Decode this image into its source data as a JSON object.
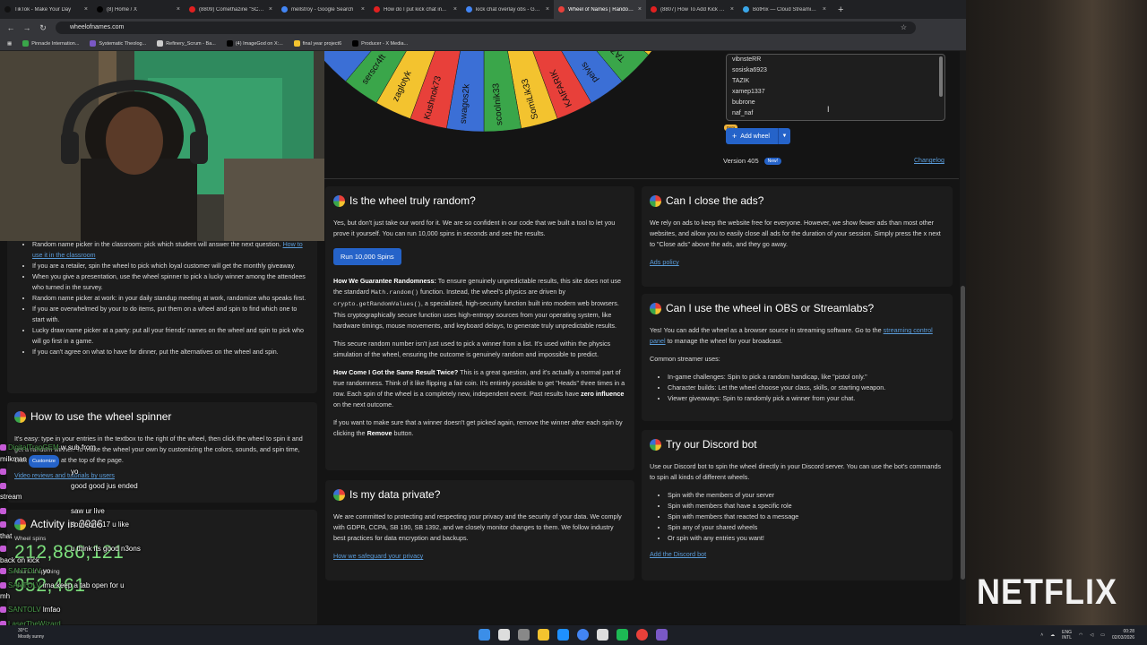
{
  "browser": {
    "tabs": [
      {
        "label": "TikTok - Make Your Day",
        "color": "#111111",
        "active": false
      },
      {
        "label": "(8) Home / X",
        "color": "#000000",
        "active": false
      },
      {
        "label": "(8809) Comethazine \"SCU...",
        "color": "#e02020",
        "active": false
      },
      {
        "label": "mellstroy - Google Search",
        "color": "#4285f4",
        "active": false
      },
      {
        "label": "How do I put kick chat in...",
        "color": "#e02020",
        "active": false
      },
      {
        "label": "kick chat overlay obs - Go...",
        "color": "#4285f4",
        "active": false
      },
      {
        "label": "Wheel of Names | Random...",
        "color": "#e8403a",
        "active": true
      },
      {
        "label": "(8807) How To Add Kick C...",
        "color": "#e02020",
        "active": false
      },
      {
        "label": "BotRix — Cloud Streaming...",
        "color": "#3aa6e8",
        "active": false
      }
    ],
    "new_tab": "+",
    "window_controls": [
      "—",
      "□",
      "✕"
    ],
    "url": "wheelofnames.com",
    "bookmarks": [
      {
        "label": "Pinnacle Internation...",
        "color": "#3aa64a"
      },
      {
        "label": "Systematic Theolog...",
        "color": "#7a58c6"
      },
      {
        "label": "Refinery_Scrum - Ba...",
        "color": "#cccccc"
      },
      {
        "label": "(4) ImageGod on X:...",
        "color": "#000000"
      },
      {
        "label": "final year project6",
        "color": "#f3c32f"
      },
      {
        "label": "Producer - X Media...",
        "color": "#000000"
      }
    ]
  },
  "wheel": {
    "names": [
      "TAZIK",
      "pelvis",
      "KAIFARIK",
      "SomiLik33",
      "scoolnik33",
      "swagos2k",
      "Kushnok73",
      "zaglotyk",
      "serscr4ft"
    ],
    "entries": [
      "vibnsteRR",
      "sosiska6923",
      "TAZIK",
      "xamep1337",
      "bubrone",
      "naf_naf"
    ],
    "add_wheel_label": "Add wheel",
    "beta_label": "Beta",
    "version_label": "Version 405",
    "new_badge": "New!",
    "changelog_label": "Changelog"
  },
  "left": {
    "list_items": [
      "Random name picker in the classroom: pick which student will answer the next question.",
      "If you are a retailer, spin the wheel to pick which loyal customer will get the monthly giveaway.",
      "When you give a presentation, use the wheel spinner to pick a lucky winner among the attendees who turned in the survey.",
      "Random name picker at work: in your daily standup meeting at work, randomize who speaks first.",
      "If you are overwhelmed by your to do items, put them on a wheel and spin to find which one to start with.",
      "Lucky draw name picker at a party: put all your friends' names on the wheel and spin to pick who will go first in a game.",
      "If you can't agree on what to have for dinner, put the alternatives on the wheel and spin."
    ],
    "classroom_link": "How to use it in the classroom",
    "howto_title": "How to use the wheel spinner",
    "howto_text": "It's easy: type in your entries in the textbox to the right of the wheel, then click the wheel to spin it and get a random winner. To make the wheel your own by customizing the colors, sounds, and spin time, click",
    "customize_chip": "Customize",
    "howto_tail": "at the top of the page.",
    "video_link": "Video reviews and tutorials by users",
    "activity_title": "Activity in 2026",
    "spins_label": "Wheel spins",
    "spins_value": "212,886,121",
    "hours_label": "Hours of spinning",
    "hours_value": "952,461"
  },
  "cards": {
    "random": {
      "title": "Is the wheel truly random?",
      "p1": "Yes, but don't just take our word for it. We are so confident in our code that we built a tool to let you prove it yourself. You can run 10,000 spins in seconds and see the results.",
      "button": "Run 10,000 Spins",
      "p2_bold": "How We Guarantee Randomness:",
      "p2_a": "To ensure genuinely unpredictable results, this site does not use the standard",
      "p2_code1": "Math.random()",
      "p2_b": "function. Instead, the wheel's physics are driven by",
      "p2_code2": "crypto.getRandomValues()",
      "p2_c": ", a specialized, high-security function built into modern web browsers. This cryptographically secure function uses high-entropy sources from your operating system, like hardware timings, mouse movements, and keyboard delays, to generate truly unpredictable results.",
      "p3": "This secure random number isn't just used to pick a winner from a list. It's used within the physics simulation of the wheel, ensuring the outcome is genuinely random and impossible to predict.",
      "p4_bold": "How Come I Got the Same Result Twice?",
      "p4_a": "This is a great question, and it's actually a normal part of true randomness. Think of it like flipping a fair coin. It's entirely possible to get \"Heads\" three times in a row. Each spin of the wheel is a completely new, independent event. Past results have",
      "p4_bold2": "zero influence",
      "p4_b": "on the next outcome.",
      "p5_a": "If you want to make sure that a winner doesn't get picked again, remove the winner after each spin by clicking the",
      "p5_bold": "Remove",
      "p5_b": "button."
    },
    "privacy": {
      "title": "Is my data private?",
      "p1": "We are committed to protecting and respecting your privacy and the security of your data. We comply with GDPR, CCPA, SB 190, SB 1392, and we closely monitor changes to them. We follow industry best practices for data encryption and backups.",
      "link": "How we safeguard your privacy"
    },
    "ads": {
      "title": "Can I close the ads?",
      "p1": "We rely on ads to keep the website free for everyone. However, we show fewer ads than most other websites, and allow you to easily close all ads for the duration of your session. Simply press the x next to \"Close ads\" above the ads, and they go away.",
      "link": "Ads policy"
    },
    "obs": {
      "title": "Can I use the wheel in OBS or Streamlabs?",
      "p1_a": "Yes! You can add the wheel as a browser source in streaming software. Go to the",
      "p1_link": "streaming control panel",
      "p1_b": "to manage the wheel for your broadcast.",
      "p2": "Common streamer uses:",
      "items": [
        "In-game challenges: Spin to pick a random handicap, like \"pistol only.\"",
        "Character builds: Let the wheel choose your class, skills, or starting weapon.",
        "Viewer giveaways: Spin to randomly pick a winner from your chat."
      ]
    },
    "discord": {
      "title": "Try our Discord bot",
      "p1": "Use our Discord bot to spin the wheel directly in your Discord server. You can use the bot's commands to spin all kinds of different wheels.",
      "items": [
        "Spin with the members of your server",
        "Spin with members that have a specific role",
        "Spin with members that reacted to a message",
        "Spin any of your shared wheels",
        "Or spin with any entries you want!"
      ],
      "link": "Add the Discord bot"
    }
  },
  "chat": [
    {
      "who": "DigitalTrapGEM",
      "text": "w sub from"
    },
    {
      "who": "",
      "text": "milkman"
    },
    {
      "who": "",
      "text": "yo"
    },
    {
      "who": "",
      "text": "good good jus ended"
    },
    {
      "who": "",
      "text": "stream"
    },
    {
      "who": "",
      "text": "saw ur live"
    },
    {
      "who": "",
      "text": "someone 17 u like"
    },
    {
      "who": "",
      "text": "that"
    },
    {
      "who": "",
      "text": "u think its good n3ons"
    },
    {
      "who": "",
      "text": "back on kick"
    },
    {
      "who": "SANTOLV",
      "text": "yo"
    },
    {
      "who": "SANTOLV",
      "text": "ima keep a tab open for u"
    },
    {
      "who": "",
      "text": "mh"
    },
    {
      "who": "SANTOLV",
      "text": "lmfao"
    },
    {
      "who": "LaserTheWizard",
      "text": ""
    }
  ],
  "overlay": {
    "netflix": "NETFLIX"
  },
  "taskbar": {
    "temp": "30°C",
    "weather": "Mostly sunny",
    "lang_top": "ENG",
    "lang_bottom": "INTL",
    "time": "00:28",
    "date": "02/03/2026",
    "icon_colors": [
      "#3b8ee8",
      "#dddddd",
      "#888888",
      "#f3c32f",
      "#1e90ff",
      "#4285f4",
      "#dddddd",
      "#1db954",
      "#e8403a",
      "#7a58c6"
    ]
  }
}
